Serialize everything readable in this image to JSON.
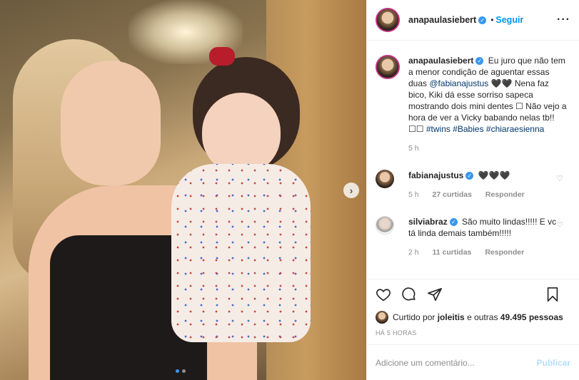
{
  "header": {
    "username": "anapaulasiebert",
    "separator": "•",
    "follow_label": "Seguir",
    "more_label": "···"
  },
  "caption": {
    "username": "anapaulasiebert",
    "text_1": "Eu juro que não tem a menor condição de aguentar essas duas",
    "mention": "@fabianajustus",
    "text_2": "🖤🖤 Nena faz bico, Kiki dá esse sorriso sapeca mostrando dois mini dentes ☐ Não vejo a hora de ver a Vicky babando nelas tb!! ☐☐",
    "tags": "#twins #Babies #chiaraesienna",
    "age": "5 h"
  },
  "comments": [
    {
      "username": "fabianajustus",
      "text": "🖤🖤🖤",
      "age": "5 h",
      "likes": "27 curtidas",
      "reply_label": "Responder",
      "heart": "♡"
    },
    {
      "username": "silviabraz",
      "text": "São muito lindas!!!!! E vc tá linda demais também!!!!!",
      "age": "2 h",
      "likes": "11 curtidas",
      "reply_label": "Responder",
      "heart": "♡"
    }
  ],
  "actions": {
    "liked_by_prefix": "Curtido por",
    "liked_by_user": "joleitis",
    "liked_by_middle": "e outras",
    "liked_by_count": "49.495 pessoas",
    "timestamp": "HÁ 5 HORAS"
  },
  "add_comment": {
    "placeholder": "Adicione um comentário...",
    "post_label": "Publicar"
  },
  "photo": {
    "next_label": "›",
    "slide_index": 1,
    "slide_count": 2
  },
  "colors": {
    "accent": "#0095f6",
    "verified": "#3897f0",
    "muted": "#8e8e8e"
  }
}
